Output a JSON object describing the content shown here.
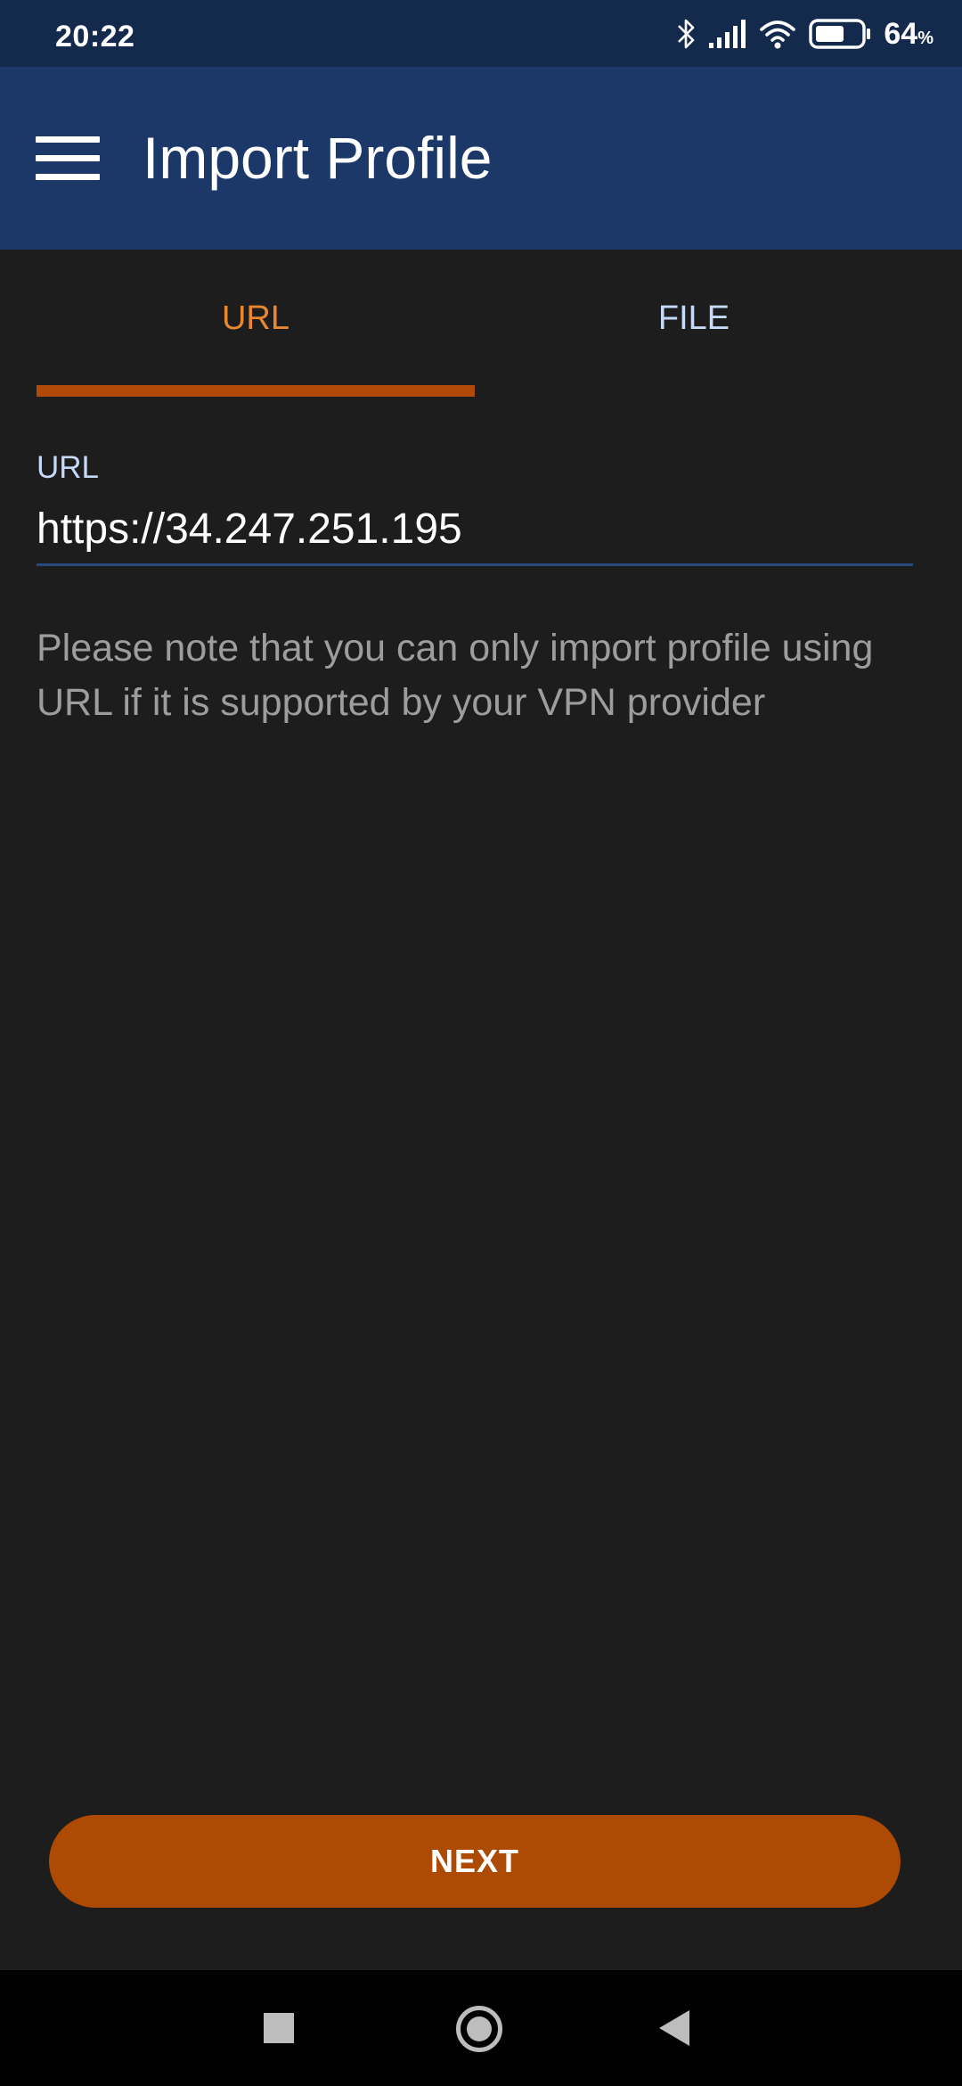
{
  "status_bar": {
    "time": "20:22",
    "battery_percent": "64",
    "battery_unit": "%",
    "battery_level": 0.64,
    "icons": [
      "bluetooth-icon",
      "signal-icon",
      "wifi-icon",
      "battery-icon"
    ]
  },
  "app_bar": {
    "title": "Import Profile",
    "menu_icon": "hamburger-menu-icon"
  },
  "tabs": [
    {
      "label": "URL",
      "selected": true
    },
    {
      "label": "FILE",
      "selected": false
    }
  ],
  "url_field": {
    "label": "URL",
    "value": "https://34.247.251.195"
  },
  "note": "Please note that you can only import profile using URL if it is supported by your VPN provider",
  "next_button": {
    "label": "NEXT"
  },
  "nav_bar": {
    "buttons": [
      "recents-icon",
      "home-icon",
      "back-icon"
    ]
  },
  "colors": {
    "status_bar_bg": "#132a4d",
    "app_bar_bg": "#1b3868",
    "background": "#1d1d1d",
    "accent": "#ad4a04",
    "tab_selected": "#e8872f",
    "tab_unselected": "#c6d9f7"
  }
}
